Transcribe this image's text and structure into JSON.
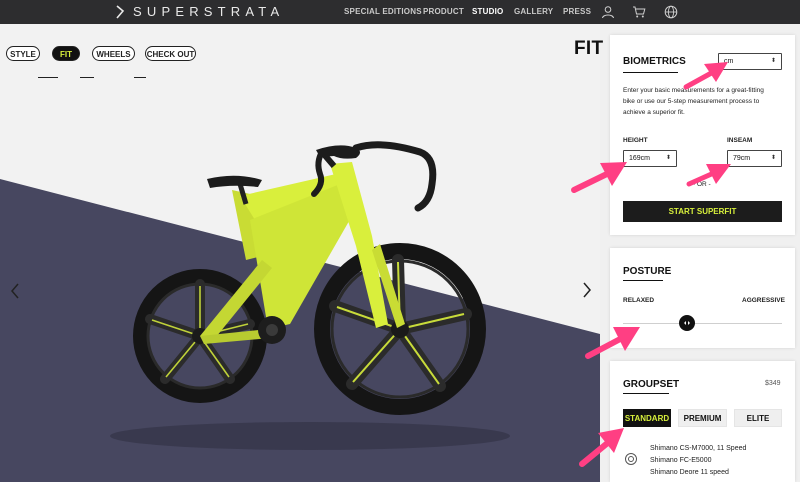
{
  "header": {
    "brand": "SUPERSTRATA",
    "nav": [
      "SPECIAL EDITIONS",
      "PRODUCT",
      "STUDIO",
      "GALLERY",
      "PRESS"
    ],
    "active_nav": "STUDIO",
    "icons": [
      "user-icon",
      "cart-icon",
      "globe-icon"
    ]
  },
  "steps": [
    "STYLE",
    "FIT",
    "WHEELS",
    "CHECK OUT"
  ],
  "active_step": "FIT",
  "page_title": "FIT",
  "biometrics": {
    "title": "BIOMETRICS",
    "unit": "cm",
    "description_lines": [
      "Enter your basic measurements for a great-fitting",
      "bike or use our 5-step measurement process to",
      "achieve a superior fit."
    ],
    "height_label": "HEIGHT",
    "height_value": "169cm",
    "inseam_label": "INSEAM",
    "inseam_value": "79cm",
    "or_label": "- OR -",
    "start_button": "START SUPERFIT"
  },
  "posture": {
    "title": "POSTURE",
    "left_label": "RELAXED",
    "right_label": "AGGRESSIVE",
    "level": 0.4
  },
  "groupset": {
    "title": "GROUPSET",
    "price": "$349",
    "options": [
      "STANDARD",
      "PREMIUM",
      "ELITE"
    ],
    "selected": "STANDARD",
    "components": [
      "Shimano CS-M7000, 11 Speed",
      "Shimano FC-E5000",
      "Shimano Deore 11 speed"
    ]
  },
  "colors": {
    "header_bg": "#2d2d2f",
    "accent": "#d8f03c",
    "annotation_arrow": "#ff3f83",
    "floor": "#474760",
    "bike_frame": "#d9ef3c"
  }
}
